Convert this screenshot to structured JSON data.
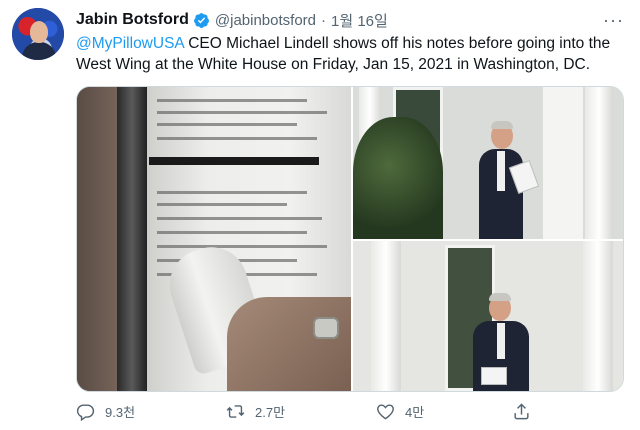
{
  "tweet": {
    "author_name": "Jabin Botsford",
    "handle": "@jabinbotsford",
    "separator": "·",
    "timestamp": "1월 16일",
    "more_icon": "more-icon",
    "mention": "@MyPillowUSA",
    "text": " CEO Michael Lindell shows off his notes before going into the West Wing at the White House on Friday, Jan 15, 2021 in Washington, DC.",
    "verified_icon": "verified-badge-icon"
  },
  "media": {
    "photos": [
      "notes-closeup-photo",
      "lindell-outside-photo",
      "lindell-portico-photo"
    ]
  },
  "actions": {
    "reply_count": "9.3천",
    "retweet_count": "2.7만",
    "like_count": "4만",
    "share_icon": "share-icon"
  },
  "colors": {
    "accent": "#1d9bf0",
    "secondary_text": "#536471",
    "primary_text": "#0f1419"
  }
}
